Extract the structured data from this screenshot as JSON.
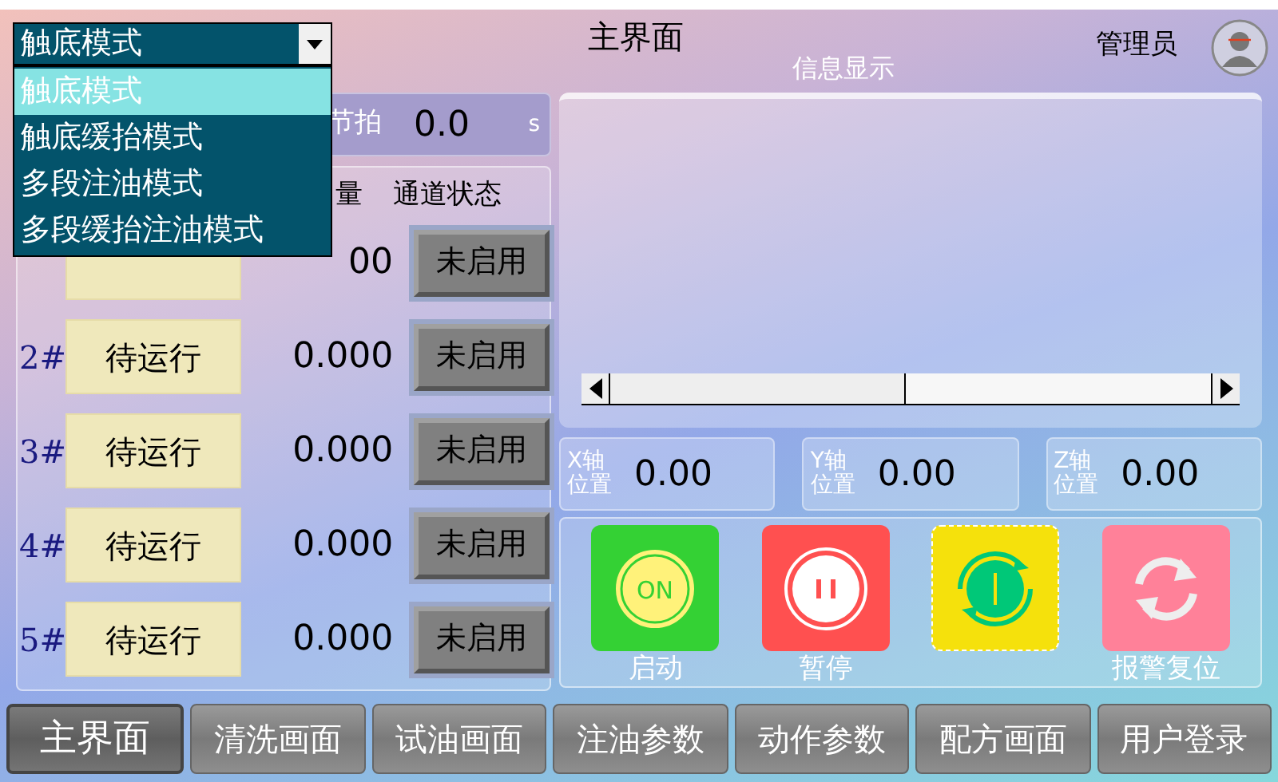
{
  "header": {
    "title": "主界面",
    "user": "管理员"
  },
  "mode_select": {
    "value": "触底模式",
    "expanded": true,
    "options": [
      {
        "label": "触底模式",
        "selected": true
      },
      {
        "label": "触底缓抬模式",
        "selected": false
      },
      {
        "label": "多段注油模式",
        "selected": false
      },
      {
        "label": "多段缓抬注油模式",
        "selected": false
      }
    ]
  },
  "cycle": {
    "label": "节拍",
    "value": "0.0",
    "unit": "s"
  },
  "channels": {
    "headers": [
      "量",
      "通道状态"
    ],
    "rows": [
      {
        "value": "00",
        "state": "未启用"
      },
      {
        "label": "2#",
        "status": "待运行",
        "value": "0.000",
        "state": "未启用"
      },
      {
        "label": "3#",
        "status": "待运行",
        "value": "0.000",
        "state": "未启用"
      },
      {
        "label": "4#",
        "status": "待运行",
        "value": "0.000",
        "state": "未启用"
      },
      {
        "label": "5#",
        "status": "待运行",
        "value": "0.000",
        "state": "未启用"
      }
    ]
  },
  "info": {
    "title": "信息显示"
  },
  "axes": [
    {
      "label": "X轴位置",
      "value": "0.00"
    },
    {
      "label": "Y轴位置",
      "value": "0.00"
    },
    {
      "label": "Z轴位置",
      "value": "0.00"
    }
  ],
  "controls": [
    {
      "kind": "on",
      "label": "启动",
      "icon_text": "ON"
    },
    {
      "kind": "pause",
      "label": "暂停"
    },
    {
      "kind": "cycle"
    },
    {
      "kind": "reset",
      "label": "报警复位"
    }
  ],
  "nav": [
    {
      "label": "主界面",
      "selected": true
    },
    {
      "label": "清洗画面",
      "selected": false
    },
    {
      "label": "试油画面",
      "selected": false
    },
    {
      "label": "注油参数",
      "selected": false
    },
    {
      "label": "动作参数",
      "selected": false
    },
    {
      "label": "配方画面",
      "selected": false
    },
    {
      "label": "用户登录",
      "selected": false
    }
  ]
}
